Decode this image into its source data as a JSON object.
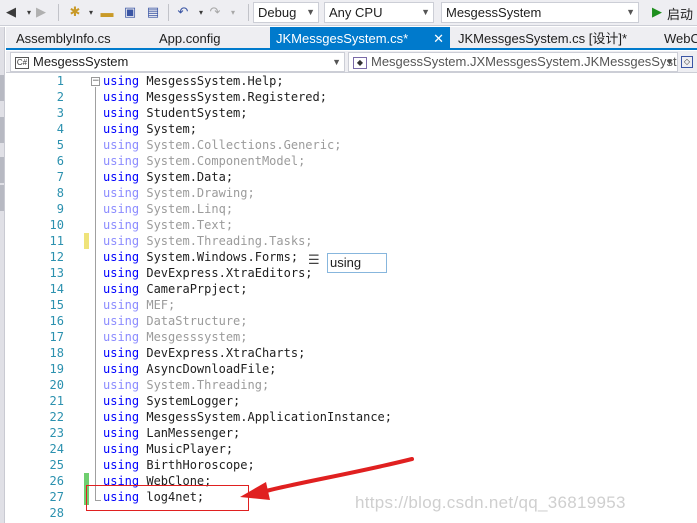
{
  "toolbar": {
    "config_combo": "Debug",
    "platform_combo": "Any CPU",
    "project_combo": "MesgessSystem",
    "start_label": "启动",
    "start_icon": "play-icon",
    "start_color": "#1e8f1e"
  },
  "tabs": [
    {
      "label": "AssemblyInfo.cs",
      "active": false
    },
    {
      "label": "App.config",
      "active": false
    },
    {
      "label": "JKMessgesSystem.cs*",
      "active": true
    },
    {
      "label": "JKMessgesSystem.cs [设计]*",
      "active": false
    },
    {
      "label": "WebC",
      "active": false
    }
  ],
  "active_tab_close": "✕",
  "navbar": {
    "project": "MesgessSystem",
    "type": "MesgessSystem.JXMessgesSystem.JKMessgesSyste"
  },
  "editor": {
    "lines": [
      {
        "n": "1",
        "kw": "using",
        "ns": " MesgessSystem.Help;",
        "faded": false
      },
      {
        "n": "2",
        "kw": "using",
        "ns": " MesgessSystem.Registered;",
        "faded": false
      },
      {
        "n": "3",
        "kw": "using",
        "ns": " StudentSystem;",
        "faded": false
      },
      {
        "n": "4",
        "kw": "using",
        "ns": " System;",
        "faded": false
      },
      {
        "n": "5",
        "kw": "using",
        "ns": " System.Collections.Generic;",
        "faded": true
      },
      {
        "n": "6",
        "kw": "using",
        "ns": " System.ComponentModel;",
        "faded": true
      },
      {
        "n": "7",
        "kw": "using",
        "ns": " System.Data;",
        "faded": false
      },
      {
        "n": "8",
        "kw": "using",
        "ns": " System.Drawing;",
        "faded": true
      },
      {
        "n": "9",
        "kw": "using",
        "ns": " System.Linq;",
        "faded": true
      },
      {
        "n": "10",
        "kw": "using",
        "ns": " System.Text;",
        "faded": true
      },
      {
        "n": "11",
        "kw": "using",
        "ns": " System.Threading.Tasks;",
        "faded": true
      },
      {
        "n": "12",
        "kw": "using",
        "ns": " System.Windows.Forms;",
        "faded": false
      },
      {
        "n": "13",
        "kw": "using",
        "ns": " DevExpress.XtraEditors;",
        "faded": false
      },
      {
        "n": "14",
        "kw": "using",
        "ns": " CameraPrpject;",
        "faded": false
      },
      {
        "n": "15",
        "kw": "using",
        "ns": " MEF;",
        "faded": true
      },
      {
        "n": "16",
        "kw": "using",
        "ns": " DataStructure;",
        "faded": true
      },
      {
        "n": "17",
        "kw": "using",
        "ns": " Mesgesssystem;",
        "faded": true
      },
      {
        "n": "18",
        "kw": "using",
        "ns": " DevExpress.XtraCharts;",
        "faded": false
      },
      {
        "n": "19",
        "kw": "using",
        "ns": " AsyncDownloadFile;",
        "faded": false
      },
      {
        "n": "20",
        "kw": "using",
        "ns": " System.Threading;",
        "faded": true
      },
      {
        "n": "21",
        "kw": "using",
        "ns": " SystemLogger;",
        "faded": false
      },
      {
        "n": "22",
        "kw": "using",
        "ns": " MesgessSystem.ApplicationInstance;",
        "faded": false
      },
      {
        "n": "23",
        "kw": "using",
        "ns": " LanMessenger;",
        "faded": false
      },
      {
        "n": "24",
        "kw": "using",
        "ns": " MusicPlayer;",
        "faded": false
      },
      {
        "n": "25",
        "kw": "using",
        "ns": " BirthHoroscope;",
        "faded": false
      },
      {
        "n": "26",
        "kw": "using",
        "ns": " WebClone;",
        "faded": false
      },
      {
        "n": "27",
        "kw": "using",
        "ns": " log4net;",
        "faded": false
      },
      {
        "n": "28",
        "kw": "",
        "ns": "",
        "faded": false
      }
    ],
    "collapse_glyph": "−"
  },
  "completion": {
    "text": "using",
    "icon": "snippet-icon"
  },
  "watermark": "https://blog.csdn.net/qq_36819953",
  "colors": {
    "accent": "#007acc",
    "annotation": "#e02020",
    "keyword": "#0000ff",
    "line_number": "#2b91af"
  }
}
